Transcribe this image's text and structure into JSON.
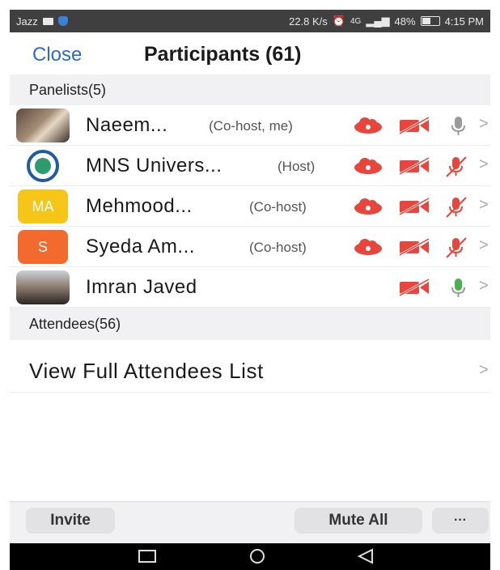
{
  "status_bar": {
    "carrier": "Jazz",
    "speed": "22.8 K/s",
    "network": "4G",
    "battery": "48%",
    "time": "4:15 PM"
  },
  "header": {
    "close_label": "Close",
    "title": "Participants (61)"
  },
  "panelists": {
    "header": "Panelists(5)",
    "items": [
      {
        "name": "Naeem...",
        "role": "(Co-host, me)",
        "avatar": "photo",
        "mic": "muted-gray"
      },
      {
        "name": "MNS Univers...",
        "role": "(Host)",
        "avatar": "logo",
        "mic": "muted-red"
      },
      {
        "name": "Mehmood...",
        "role": "(Co-host)",
        "avatar": "MA",
        "avatar_color": "#f5c518",
        "mic": "muted-red"
      },
      {
        "name": "Syeda Am...",
        "role": "(Co-host)",
        "avatar": "S",
        "avatar_color": "#f26a2e",
        "mic": "muted-red"
      },
      {
        "name": "Imran Javed",
        "role": "",
        "avatar": "photo",
        "mic": "active-green"
      }
    ]
  },
  "attendees": {
    "header": "Attendees(56)",
    "view_label": "View Full Attendees List"
  },
  "toolbar": {
    "invite_label": "Invite",
    "mute_all_label": "Mute All",
    "more_label": "···"
  },
  "colors": {
    "accent_blue": "#2d6bd2",
    "icon_red": "#e8453c",
    "mic_gray": "#9a9a9a",
    "mic_green": "#4caf50"
  },
  "icons": [
    "cloud-record-icon",
    "video-off-icon",
    "mic-muted-icon",
    "mic-active-icon",
    "chevron-right-icon",
    "nav-square-icon",
    "nav-circle-icon",
    "nav-back-icon"
  ]
}
